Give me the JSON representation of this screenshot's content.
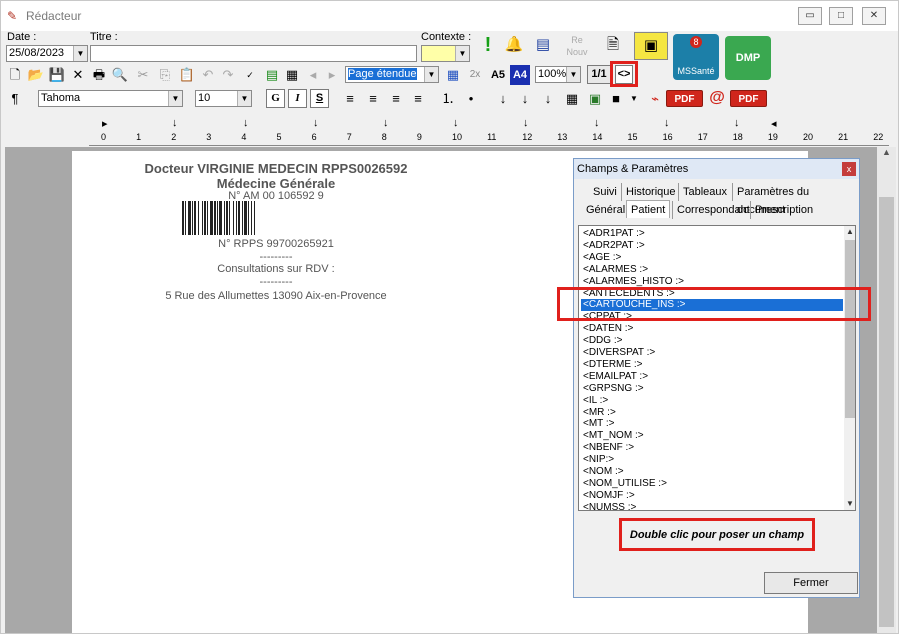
{
  "window": {
    "title": "Rédacteur",
    "min_label": "▭",
    "max_label": "□",
    "close_label": "✕"
  },
  "header": {
    "date_label": "Date :",
    "date_value": "25/08/2023",
    "title_label": "Titre :",
    "context_label": "Contexte :"
  },
  "toolbar": {
    "bigbuttons": {
      "renouv_label": "Re Nouv",
      "mssante_label": "MSSanté",
      "mssante_badge": "8",
      "dmp_label": "DMP"
    },
    "view_mode": "Page étendue",
    "a5_label": "A5",
    "a4_label": "A4",
    "zoom": "100%",
    "page_indicator": "1/1",
    "fields_toggle": "<>",
    "font_name": "Tahoma",
    "font_size": "10",
    "bold": "G",
    "italic": "I",
    "underline": "S",
    "pdf_label": "PDF",
    "pdf2_label": "PDF",
    "paragraph_icon": "¶",
    "at_label": "@",
    "twox_label": "2x"
  },
  "ruler": {
    "numbers": [
      "0",
      "1",
      "2",
      "3",
      "4",
      "5",
      "6",
      "7",
      "8",
      "9",
      "10",
      "11",
      "12",
      "13",
      "14",
      "15",
      "16",
      "17",
      "18",
      "19",
      "20",
      "21",
      "22"
    ]
  },
  "document": {
    "doctor": "Docteur VIRGINIE MEDECIN RPPS0026592",
    "specialty": "Médecine Générale",
    "am_number": "N° AM 00 106592 9",
    "rpps": "N° RPPS 99700265921",
    "sep1": "---------",
    "consult": "Consultations sur RDV :",
    "sep2": "---------",
    "address": "5 Rue des Allumettes 13090 Aix-en-Provence"
  },
  "panel": {
    "title": "Champs & Paramètres",
    "close_label": "x",
    "tabs_row1": [
      "Suivi",
      "Historique",
      "Tableaux",
      "Paramètres du document"
    ],
    "tabs_row2": [
      "Général",
      "Patient",
      "Correspondant",
      "Prescription"
    ],
    "active_tab": "Patient",
    "items": [
      "<ADR1PAT :>",
      "<ADR2PAT :>",
      "<AGE :>",
      "<ALARMES :>",
      "<ALARMES_HISTO :>",
      "<ANTECEDENTS :>",
      "<CARTOUCHE_INS :>",
      "<CPPAT :>",
      "<DATEN :>",
      "<DDG :>",
      "<DIVERSPAT :>",
      "<DTERME :>",
      "<EMAILPAT :>",
      "<GRPSNG :>",
      "<IL :>",
      "<MR :>",
      "<MT :>",
      "<MT_NOM :>",
      "<NBENF :>",
      "<NIP:>",
      "<NOM :>",
      "<NOM_UTILISE :>",
      "<NOMJF :>",
      "<NUMSS :>"
    ],
    "selected_item": "<CARTOUCHE_INS :>",
    "hint": "Double clic pour poser un champ",
    "close_button": "Fermer"
  },
  "colors": {
    "highlight_red": "#e0201c",
    "selection_blue": "#1a6fd6",
    "pdf_red": "#d0261c"
  }
}
